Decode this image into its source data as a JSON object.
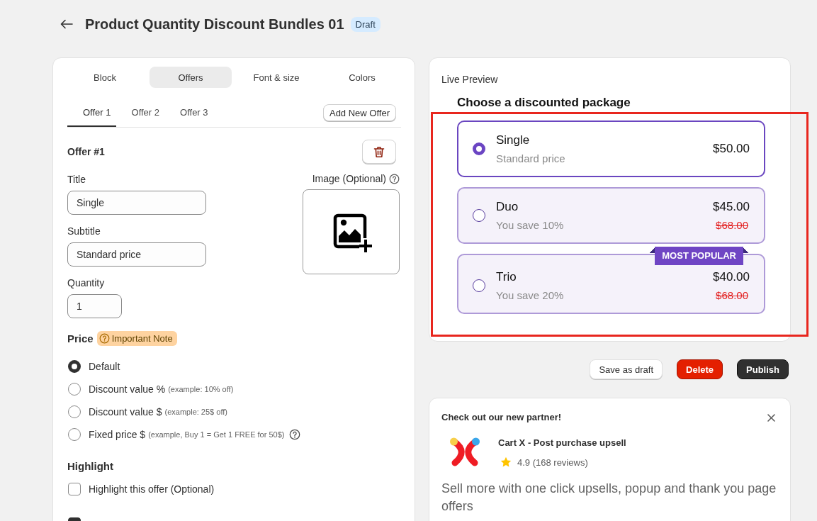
{
  "header": {
    "title": "Product Quantity Discount Bundles 01",
    "status": "Draft"
  },
  "editor": {
    "tabs": [
      {
        "label": "Block",
        "selected": false
      },
      {
        "label": "Offers",
        "selected": true
      },
      {
        "label": "Font & size",
        "selected": false
      },
      {
        "label": "Colors",
        "selected": false
      }
    ],
    "offer_tabs": [
      {
        "label": "Offer 1",
        "selected": true
      },
      {
        "label": "Offer 2",
        "selected": false
      },
      {
        "label": "Offer 3",
        "selected": false
      }
    ],
    "add_offer_button": "Add New Offer",
    "offer_heading": "Offer #1",
    "fields": [
      {
        "kind": "text",
        "label": "Title",
        "value": "Single"
      },
      {
        "kind": "text",
        "label": "Subtitle",
        "value": "Standard price"
      },
      {
        "kind": "number",
        "label": "Quantity",
        "value": "1"
      }
    ],
    "image": {
      "label": "Image (Optional)"
    },
    "price": {
      "label": "Price",
      "note": "Important Note",
      "options": [
        {
          "label": "Default",
          "selected": true,
          "help": false
        },
        {
          "label": "Discount value %",
          "hint": "(example: 10% off)",
          "selected": false,
          "help": false
        },
        {
          "label": "Discount value $",
          "hint": "(example: 25$ off)",
          "selected": false,
          "help": false
        },
        {
          "label": "Fixed price $",
          "hint": "(example, Buy 1 = Get 1 FREE for 50$)",
          "selected": false,
          "help": true
        }
      ]
    },
    "highlight": {
      "label": "Highlight",
      "options": [
        {
          "label": "Highlight this offer (Optional)",
          "checked": false
        },
        {
          "checked": true
        }
      ]
    }
  },
  "preview": {
    "title": "Live Preview",
    "heading": "Choose a discounted package",
    "offers": [
      {
        "title": "Single",
        "subtitle": "Standard price",
        "price": "$50.00",
        "selected": true
      },
      {
        "title": "Duo",
        "subtitle": "You save 10%",
        "price": "$45.00",
        "compare_price": "$68.00",
        "selected": false
      },
      {
        "title": "Trio",
        "subtitle": "You save 20%",
        "price": "$40.00",
        "compare_price": "$68.00",
        "selected": false,
        "badge": "MOST POPULAR"
      }
    ],
    "annotation": {
      "kind": "outline"
    }
  },
  "actions": [
    {
      "label": "Save as draft",
      "kind": "secondary"
    },
    {
      "label": "Delete",
      "kind": "critical"
    },
    {
      "label": "Publish",
      "kind": "primary"
    }
  ],
  "partner": {
    "heading": "Check out our new partner!",
    "name": "Cart X - Post purchase upsell",
    "rating": "4.9 (168 reviews)",
    "description": "Sell more with one click upsells, popup and thank you page offers"
  }
}
